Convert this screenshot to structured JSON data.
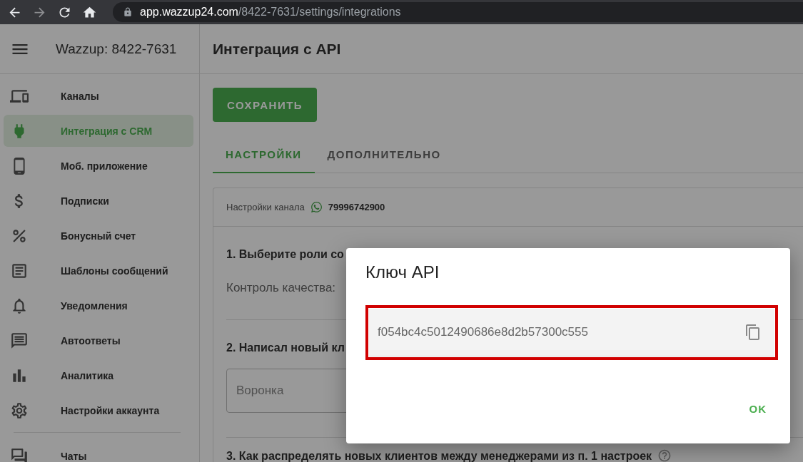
{
  "browser": {
    "url_host": "app.wazzup24.com",
    "url_path": "/8422-7631/settings/integrations"
  },
  "sidebar": {
    "title": "Wazzup: 8422-7631",
    "items": [
      {
        "label": "Каналы",
        "selected": false
      },
      {
        "label": "Интеграция с CRM",
        "selected": true
      },
      {
        "label": "Моб. приложение",
        "selected": false
      },
      {
        "label": "Подписки",
        "selected": false
      },
      {
        "label": "Бонусный счет",
        "selected": false
      },
      {
        "label": "Шаблоны сообщений",
        "selected": false
      },
      {
        "label": "Уведомления",
        "selected": false
      },
      {
        "label": "Автоответы",
        "selected": false
      },
      {
        "label": "Аналитика",
        "selected": false
      },
      {
        "label": "Настройки аккаунта",
        "selected": false
      }
    ],
    "bottom_items": [
      {
        "label": "Чаты",
        "selected": false
      }
    ]
  },
  "page": {
    "title": "Интеграция с API",
    "save_button": "СОХРАНИТЬ",
    "tabs": [
      {
        "label": "НАСТРОЙКИ",
        "selected": true
      },
      {
        "label": "ДОПОЛНИТЕЛЬНО",
        "selected": false
      }
    ],
    "card": {
      "channel_label": "Настройки канала",
      "channel_number": "79996742900",
      "section_1": {
        "heading": "1. Выберите роли со",
        "row_label": "Контроль качества:"
      },
      "section_2": {
        "heading": "2. Написал новый кл",
        "placeholder": "Воронка"
      },
      "section_3": {
        "heading": "3. Как распределять новых клиентов между менеджерами из п. 1 настроек"
      }
    }
  },
  "dialog": {
    "title": "Ключ API",
    "key": "f054bc4c5012490686e8d2b57300c555",
    "ok_button": "OK"
  }
}
